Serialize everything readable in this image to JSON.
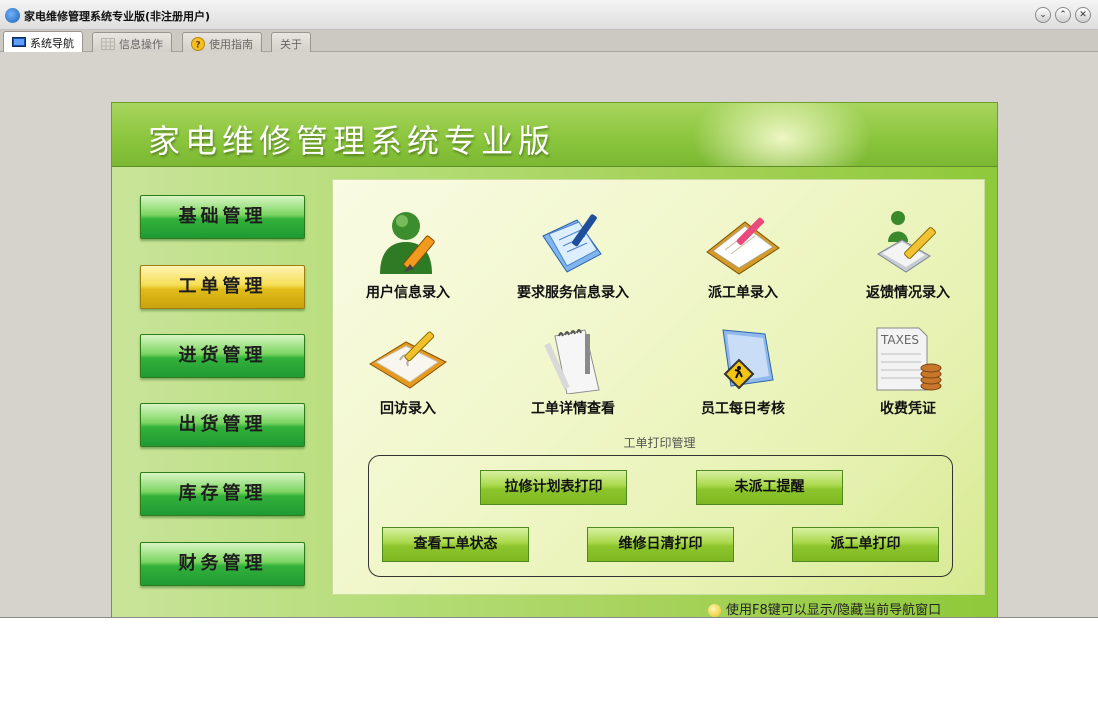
{
  "window": {
    "title": "家电维修管理系统专业版(非注册用户)"
  },
  "tabs": [
    {
      "label": "系统导航",
      "icon": "monitor-icon",
      "active": true
    },
    {
      "label": "信息操作",
      "icon": "grid-icon",
      "active": false
    },
    {
      "label": "使用指南",
      "icon": "help-icon",
      "active": false
    },
    {
      "label": "关于",
      "icon": "",
      "active": false
    }
  ],
  "header": {
    "title": "家电维修管理系统专业版"
  },
  "nav": [
    {
      "label": "基础管理",
      "active": false
    },
    {
      "label": "工单管理",
      "active": true
    },
    {
      "label": "进货管理",
      "active": false
    },
    {
      "label": "出货管理",
      "active": false
    },
    {
      "label": "库存管理",
      "active": false
    },
    {
      "label": "财务管理",
      "active": false
    }
  ],
  "functions": [
    {
      "label": "用户信息录入",
      "icon": "user-edit-icon"
    },
    {
      "label": "要求服务信息录入",
      "icon": "document-pen-icon"
    },
    {
      "label": "派工单录入",
      "icon": "clipboard-pen-icon"
    },
    {
      "label": "返馈情况录入",
      "icon": "person-pencil-icon"
    },
    {
      "label": "回访录入",
      "icon": "notebook-pen-icon"
    },
    {
      "label": "工单详情查看",
      "icon": "notepad-icon"
    },
    {
      "label": "员工每日考核",
      "icon": "folder-sign-icon"
    },
    {
      "label": "收费凭证",
      "icon": "taxes-icon"
    }
  ],
  "print_section": {
    "caption": "工单打印管理",
    "buttons": [
      "拉修计划表打印",
      "未派工提醒",
      "查看工单状态",
      "维修日清打印",
      "派工单打印"
    ]
  },
  "hint": "使用F8键可以显示/隐藏当前导航窗口",
  "taxes_icon_text": "TAXES",
  "colors": {
    "header_green": "#8cc63e",
    "nav_green": "#33b13a",
    "nav_active_gold": "#e1bd1b",
    "print_button_green": "#a9d84a"
  }
}
